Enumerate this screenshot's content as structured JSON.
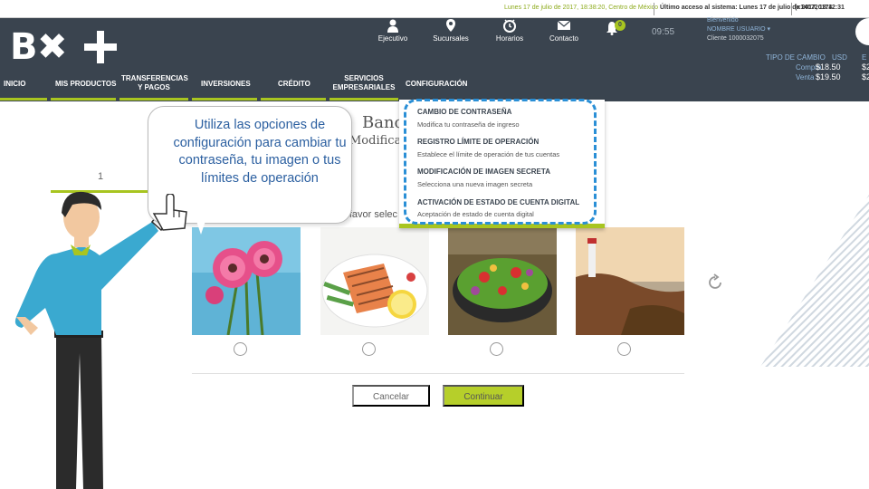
{
  "topbar": {
    "date": "Lunes 17 de julio de 2017, 18:38:20, Centro de México",
    "last_access": "Último acceso al sistema: Lunes 17 de julio de 2017, 18:12:31",
    "client_id": "(x140720174"
  },
  "header": {
    "logo": "BX+",
    "icons": [
      {
        "label": "Ejecutivo",
        "icon": "person-icon"
      },
      {
        "label": "Sucursales",
        "icon": "location-pin-icon"
      },
      {
        "label": "Horarios",
        "icon": "clock-icon"
      },
      {
        "label": "Contacto",
        "icon": "envelope-icon"
      }
    ],
    "notifications_count": "0",
    "session_timer": "09:55",
    "welcome": "Bienvenido",
    "user_name": "NOMBRE USUARIO",
    "client_number": "Cliente 1000032075",
    "exchange": {
      "title": "TIPO DE CAMBIO",
      "currency": "USD",
      "currency2": "E",
      "buy_label": "Compra",
      "sell_label": "Venta",
      "buy_value": "$18.50",
      "sell_value": "$19.50",
      "buy_value2": "$2",
      "sell_value2": "$2"
    }
  },
  "nav": {
    "items": [
      {
        "label": "INICIO"
      },
      {
        "label": "MIS PRODUCTOS"
      },
      {
        "label": "TRANSFERENCIAS Y PAGOS"
      },
      {
        "label": "INVERSIONES"
      },
      {
        "label": "CRÉDITO"
      },
      {
        "label": "SERVICIOS EMPRESARIALES"
      },
      {
        "label": "CONFIGURACIÓN"
      }
    ]
  },
  "menu": {
    "items": [
      {
        "title": "CAMBIO DE CONTRASEÑA",
        "desc": "Modifica tu contraseña de ingreso"
      },
      {
        "title": "REGISTRO LÍMITE DE OPERACIÓN",
        "desc": "Establece el límite de operación de tus cuentas"
      },
      {
        "title": "MODIFICACIÓN DE IMAGEN SECRETA",
        "desc": "Selecciona una nueva imagen secreta"
      },
      {
        "title": "ACTIVACIÓN DE ESTADO DE CUENTA DIGITAL",
        "desc": "Aceptación de estado de cuenta digital"
      }
    ]
  },
  "main": {
    "tooltip": "Utiliza las opciones de configuración para cambiar tu contraseña, tu imagen o tus límites de operación",
    "heading": "Banc",
    "subheading": "Modificac",
    "instruction": "or favor selec",
    "step": "1",
    "images": [
      {
        "name": "flowers"
      },
      {
        "name": "salmon"
      },
      {
        "name": "salad"
      },
      {
        "name": "lighthouse"
      }
    ],
    "cancel_label": "Cancelar",
    "continue_label": "Continuar"
  },
  "colors": {
    "header_bg": "#3a444f",
    "accent_green": "#a8c520",
    "highlight_blue": "#2a8fd6",
    "tooltip_text": "#2b5fa0"
  }
}
